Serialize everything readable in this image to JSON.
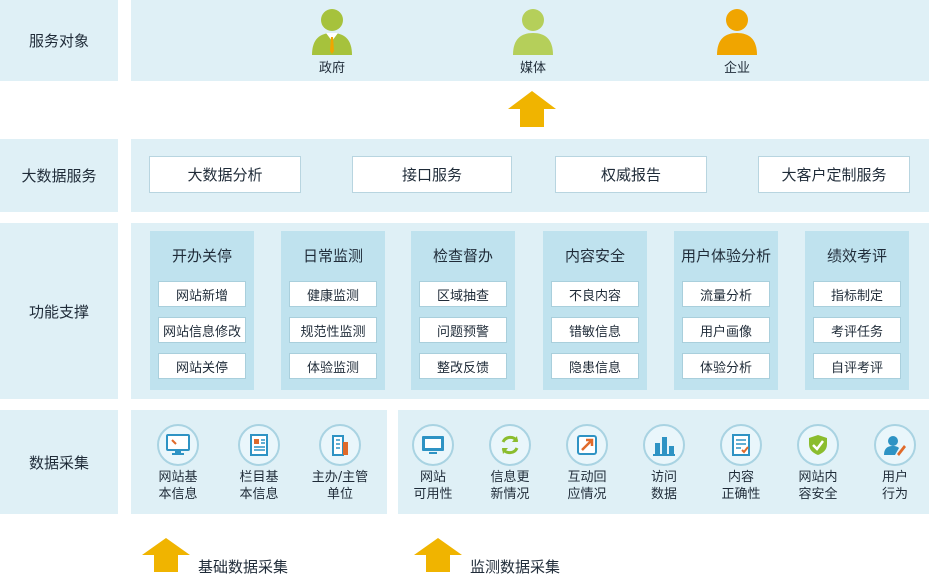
{
  "rows": {
    "service_targets": "服务对象",
    "big_data_services": "大数据服务",
    "function_support": "功能支撑",
    "data_collection": "数据采集"
  },
  "service_targets": [
    {
      "label": "政府",
      "icon": "government-person-icon",
      "color": "#a6c23c"
    },
    {
      "label": "媒体",
      "icon": "media-person-icon",
      "color": "#b5cf5a"
    },
    {
      "label": "企业",
      "icon": "enterprise-person-icon",
      "color": "#f0a500"
    }
  ],
  "big_data_services": [
    "大数据分析",
    "接口服务",
    "权威报告",
    "大客户定制服务"
  ],
  "functions": [
    {
      "title": "开办关停",
      "items": [
        "网站新增",
        "网站信息修改",
        "网站关停"
      ]
    },
    {
      "title": "日常监测",
      "items": [
        "健康监测",
        "规范性监测",
        "体验监测"
      ]
    },
    {
      "title": "检查督办",
      "items": [
        "区域抽查",
        "问题预警",
        "整改反馈"
      ]
    },
    {
      "title": "内容安全",
      "items": [
        "不良内容",
        "错敏信息",
        "隐患信息"
      ]
    },
    {
      "title": "用户体验分析",
      "items": [
        "流量分析",
        "用户画像",
        "体验分析"
      ]
    },
    {
      "title": "绩效考评",
      "items": [
        "指标制定",
        "考评任务",
        "自评考评"
      ]
    }
  ],
  "basic_collection": [
    {
      "line1": "网站基",
      "line2": "本信息",
      "icon": "monitor-icon"
    },
    {
      "line1": "栏目基",
      "line2": "本信息",
      "icon": "document-icon"
    },
    {
      "line1": "主办/主管",
      "line2": "单位",
      "icon": "building-icon"
    }
  ],
  "monitor_collection": [
    {
      "line1": "网站",
      "line2": "可用性",
      "icon": "screen-icon"
    },
    {
      "line1": "信息更",
      "line2": "新情况",
      "icon": "refresh-icon"
    },
    {
      "line1": "互动回",
      "line2": "应情况",
      "icon": "interaction-icon"
    },
    {
      "line1": "访问",
      "line2": "数据",
      "icon": "bar-chart-icon"
    },
    {
      "line1": "内容",
      "line2": "正确性",
      "icon": "checklist-icon"
    },
    {
      "line1": "网站内",
      "line2": "容安全",
      "icon": "shield-icon"
    },
    {
      "line1": "用户",
      "line2": "行为",
      "icon": "user-edit-icon"
    }
  ],
  "legend": {
    "basic": "基础数据采集",
    "monitor": "监测数据采集",
    "arrow_color": "#f0b400"
  }
}
